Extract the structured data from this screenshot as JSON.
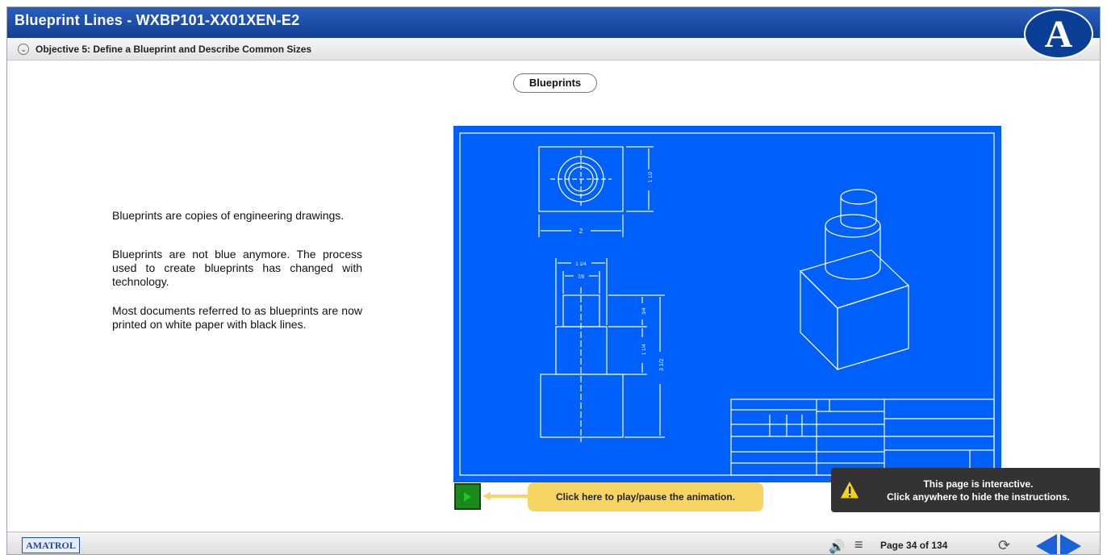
{
  "header": {
    "title": "Blueprint Lines - WXBP101-XX01XEN-E2",
    "logo_letter": "A"
  },
  "objective": {
    "label": "Objective 5: Define a Blueprint and Describe Common Sizes"
  },
  "content": {
    "section_label": "Blueprints",
    "paragraphs": [
      "Blueprints are copies of engineering drawings.",
      "Blueprints are not blue anymore. The process used to create blueprints has changed with technology.",
      "Most documents referred to as blueprints are now printed on white paper with black lines."
    ]
  },
  "drawing": {
    "background_color": "#0060fb",
    "dim_width": "2",
    "dim_height": "1 1/2",
    "dim_top1": "1 1/4",
    "dim_top2": "7/8",
    "dim_side1": "3/4",
    "dim_side2": "1 1/4",
    "dim_side3": "3 1/2"
  },
  "controls": {
    "play_callout": "Click here to play/pause the animation.",
    "info_line1": "This page is interactive.",
    "info_line2": "Click anywhere to hide the instructions."
  },
  "footer": {
    "brand": "AMATROL",
    "page": "Page 34 of 134",
    "volume_icon": "speaker-icon",
    "menu_icon": "menu-icon",
    "reload_icon": "reload-icon"
  },
  "colors": {
    "header_blue": "#1a4fae",
    "nav_blue": "#1a62d6",
    "callout_yellow": "#f7d565"
  }
}
